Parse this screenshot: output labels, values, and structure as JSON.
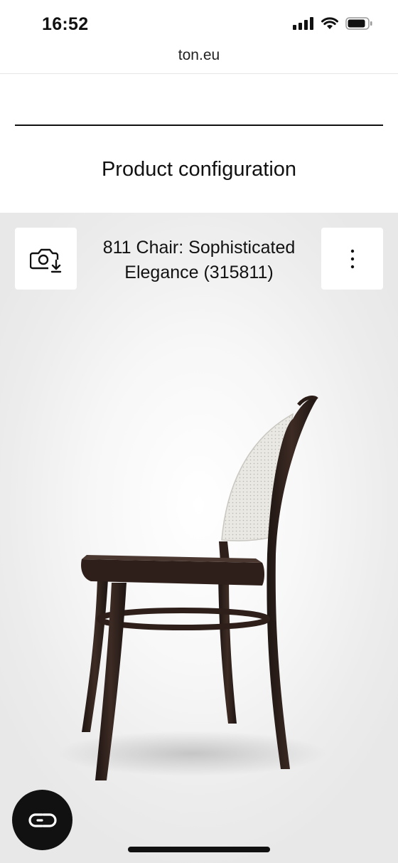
{
  "status_bar": {
    "time": "16:52",
    "icons": [
      "cellular-signal-icon",
      "wifi-icon",
      "battery-icon"
    ]
  },
  "browser": {
    "url": "ton.eu"
  },
  "page": {
    "title": "Product configuration"
  },
  "configurator": {
    "product_name": "811 Chair: Sophisticated Elegance (315811)",
    "toolbar": {
      "snapshot_icon": "camera-download-icon",
      "more_icon": "more-vertical-icon"
    },
    "ar_button_icon": "ar-view-icon"
  },
  "colors": {
    "frame_wood": "#2e1f1a",
    "cane_back": "#e9e8e3",
    "viewer_bg": "#ececec",
    "ar_button": "#111111"
  }
}
